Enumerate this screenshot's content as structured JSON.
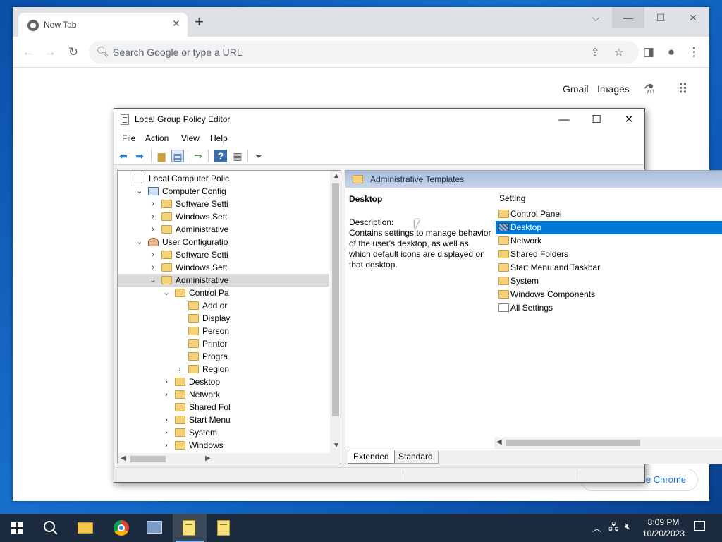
{
  "chrome": {
    "tab_title": "New Tab",
    "new_tab_symbol": "+",
    "omnibox_placeholder": "Search Google or type a URL",
    "links": [
      "Gmail",
      "Images"
    ],
    "manage_chrome_text": "ze Chrome"
  },
  "gpe": {
    "title": "Local Group Policy Editor",
    "menu": [
      "File",
      "Action",
      "View",
      "Help"
    ],
    "tree": [
      {
        "label": "Local Computer Polic",
        "icon": "doc-icon",
        "expander": ""
      },
      {
        "label": "Computer Config",
        "icon": "computer-icon",
        "expander": "expanded"
      },
      {
        "label": "Software Setti",
        "icon": "folder-icon",
        "expander": "collapsed"
      },
      {
        "label": "Windows Sett",
        "icon": "folder-icon",
        "expander": "collapsed"
      },
      {
        "label": "Administrative",
        "icon": "folder-icon",
        "expander": "collapsed"
      },
      {
        "label": "User Configuratio",
        "icon": "user-icon",
        "expander": "expanded"
      },
      {
        "label": "Software Setti",
        "icon": "folder-icon",
        "expander": "collapsed"
      },
      {
        "label": "Windows Sett",
        "icon": "folder-icon",
        "expander": "collapsed"
      },
      {
        "label": "Administrative",
        "icon": "folder-icon",
        "expander": "expanded",
        "selected": true
      },
      {
        "label": "Control Pa",
        "icon": "folder-icon",
        "expander": "expanded"
      },
      {
        "label": "Add or",
        "icon": "folder-icon",
        "expander": ""
      },
      {
        "label": "Display",
        "icon": "folder-icon",
        "expander": ""
      },
      {
        "label": "Person",
        "icon": "folder-icon",
        "expander": ""
      },
      {
        "label": "Printer",
        "icon": "folder-icon",
        "expander": ""
      },
      {
        "label": "Progra",
        "icon": "folder-icon",
        "expander": ""
      },
      {
        "label": "Region",
        "icon": "folder-icon",
        "expander": "collapsed"
      },
      {
        "label": "Desktop",
        "icon": "folder-icon",
        "expander": "collapsed"
      },
      {
        "label": "Network",
        "icon": "folder-icon",
        "expander": "collapsed"
      },
      {
        "label": "Shared Fol",
        "icon": "folder-icon",
        "expander": ""
      },
      {
        "label": "Start Menu",
        "icon": "folder-icon",
        "expander": "collapsed"
      },
      {
        "label": "System",
        "icon": "folder-icon",
        "expander": "collapsed"
      },
      {
        "label": "Windows",
        "icon": "folder-icon",
        "expander": "collapsed"
      }
    ],
    "right": {
      "header": "Administrative Templates",
      "desc_title": "Desktop",
      "desc_label": "Description:",
      "desc_body": "Contains settings to manage behavior of the user's desktop, as well as which default icons are displayed on that desktop.",
      "column_header": "Setting",
      "items": [
        {
          "label": "Control Panel",
          "icon": "folder-icon"
        },
        {
          "label": "Desktop",
          "icon": "folder-icon",
          "selected": true
        },
        {
          "label": "Network",
          "icon": "folder-icon"
        },
        {
          "label": "Shared Folders",
          "icon": "folder-icon"
        },
        {
          "label": "Start Menu and Taskbar",
          "icon": "folder-icon"
        },
        {
          "label": "System",
          "icon": "folder-icon"
        },
        {
          "label": "Windows Components",
          "icon": "folder-icon"
        },
        {
          "label": "All Settings",
          "icon": "all-settings-icon"
        }
      ],
      "tabs": [
        "Extended",
        "Standard"
      ]
    }
  },
  "taskbar": {
    "time": "8:09 PM",
    "date": "10/20/2023"
  },
  "colors": {
    "selection": "#0078d7",
    "desktop": "#1670cc",
    "taskbar": "#1b2a3c"
  }
}
